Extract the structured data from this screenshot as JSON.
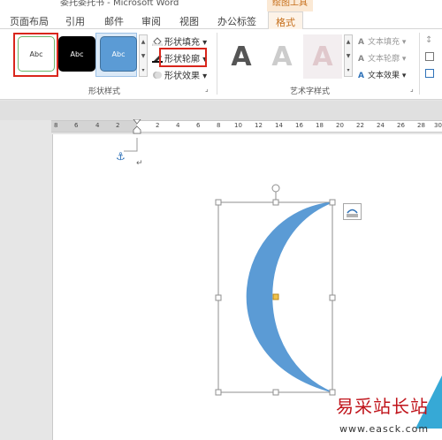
{
  "titlebar": {
    "doc_title": "委托委托书 - Microsoft Word",
    "context_tab": "绘图工具"
  },
  "tabs": [
    "页面布局",
    "引用",
    "邮件",
    "审阅",
    "视图",
    "办公标签",
    "格式"
  ],
  "shape_styles": {
    "thumbnails": [
      "Abc",
      "Abc",
      "Abc"
    ],
    "fill_label": "形状填充",
    "outline_label": "形状轮廓",
    "effects_label": "形状效果",
    "group_label": "形状样式"
  },
  "wordart": {
    "samples": [
      "A",
      "A",
      "A"
    ],
    "text_fill_label": "文本填充",
    "text_outline_label": "文本轮廓",
    "text_effects_label": "文本效果",
    "group_label": "艺术字样式"
  },
  "ruler": {
    "ticks": [
      "8",
      "6",
      "4",
      "2",
      "2",
      "4",
      "6",
      "8",
      "10",
      "12",
      "14",
      "16",
      "18",
      "20",
      "22",
      "24",
      "26",
      "28",
      "30"
    ]
  },
  "document": {
    "paragraph_mark": "↵"
  },
  "watermark": {
    "text": "易采站长站",
    "url": "www.easck.com"
  },
  "colors": {
    "shape_fill": "#5b9bd5",
    "context_accent": "#c66e1a",
    "highlight": "#d9261c"
  }
}
